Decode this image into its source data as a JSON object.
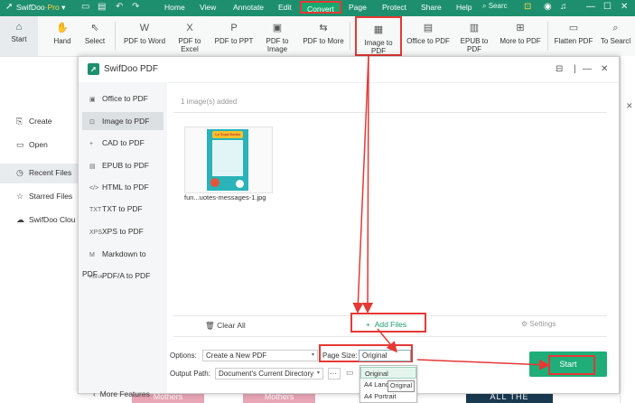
{
  "titlebar": {
    "app_name": "SwifDoo",
    "app_suffix": "·Pro",
    "menus": [
      "Home",
      "View",
      "Annotate",
      "Edit",
      "Convert",
      "Page",
      "Protect",
      "Share",
      "Help"
    ],
    "active_menu": "Convert",
    "search_placeholder": "Searc"
  },
  "ribbon": {
    "start": "Start",
    "hand": "Hand",
    "select": "Select",
    "buttons": [
      "PDF to Word",
      "PDF to Excel",
      "PDF to PPT",
      "PDF to Image",
      "PDF to More",
      "Image to PDF",
      "Office to PDF",
      "EPUB to PDF",
      "More to PDF",
      "Flatten PDF",
      "To Searcl"
    ]
  },
  "bg_sidebar": {
    "items": [
      "Create",
      "Open",
      "Recent Files",
      "Starred Files",
      "SwifDoo Clou"
    ],
    "active": "Recent Files"
  },
  "dialog": {
    "title": "SwifDoo PDF",
    "side_items": [
      "Office to PDF",
      "Image to PDF",
      "CAD to PDF",
      "EPUB to PDF",
      "HTML to PDF",
      "TXT to PDF",
      "XPS to PDF",
      "Markdown to PDF",
      "PDF/A to PDF"
    ],
    "side_icons": [
      "▣",
      "⊡",
      "+",
      "▤",
      "</>",
      "TXT",
      "XPS",
      "M",
      "PDF/A"
    ],
    "active_side": "Image to PDF",
    "added_count": "1 image(s) added",
    "thumb_banner": "La Sopa Bonita",
    "file_name": "fun...uotes-messages-1.jpg",
    "clear_all": "Clear All",
    "add_files": "Add Files",
    "settings": "Settings",
    "options_label": "Options:",
    "options_value": "Create a New PDF",
    "page_size_label": "Page Size:",
    "page_size_value": "Original",
    "output_path_label": "Output Path:",
    "output_path_value": "Document's Current Directory",
    "ellipsis": "···",
    "dropdown_options": [
      "Original",
      "A4 Landscape",
      "A4 Portrait"
    ],
    "tooltip": "Original",
    "start": "Start",
    "more_features": "More Features"
  },
  "background_thumbs": [
    "Mothers",
    "Mothers",
    "ALL THE"
  ]
}
